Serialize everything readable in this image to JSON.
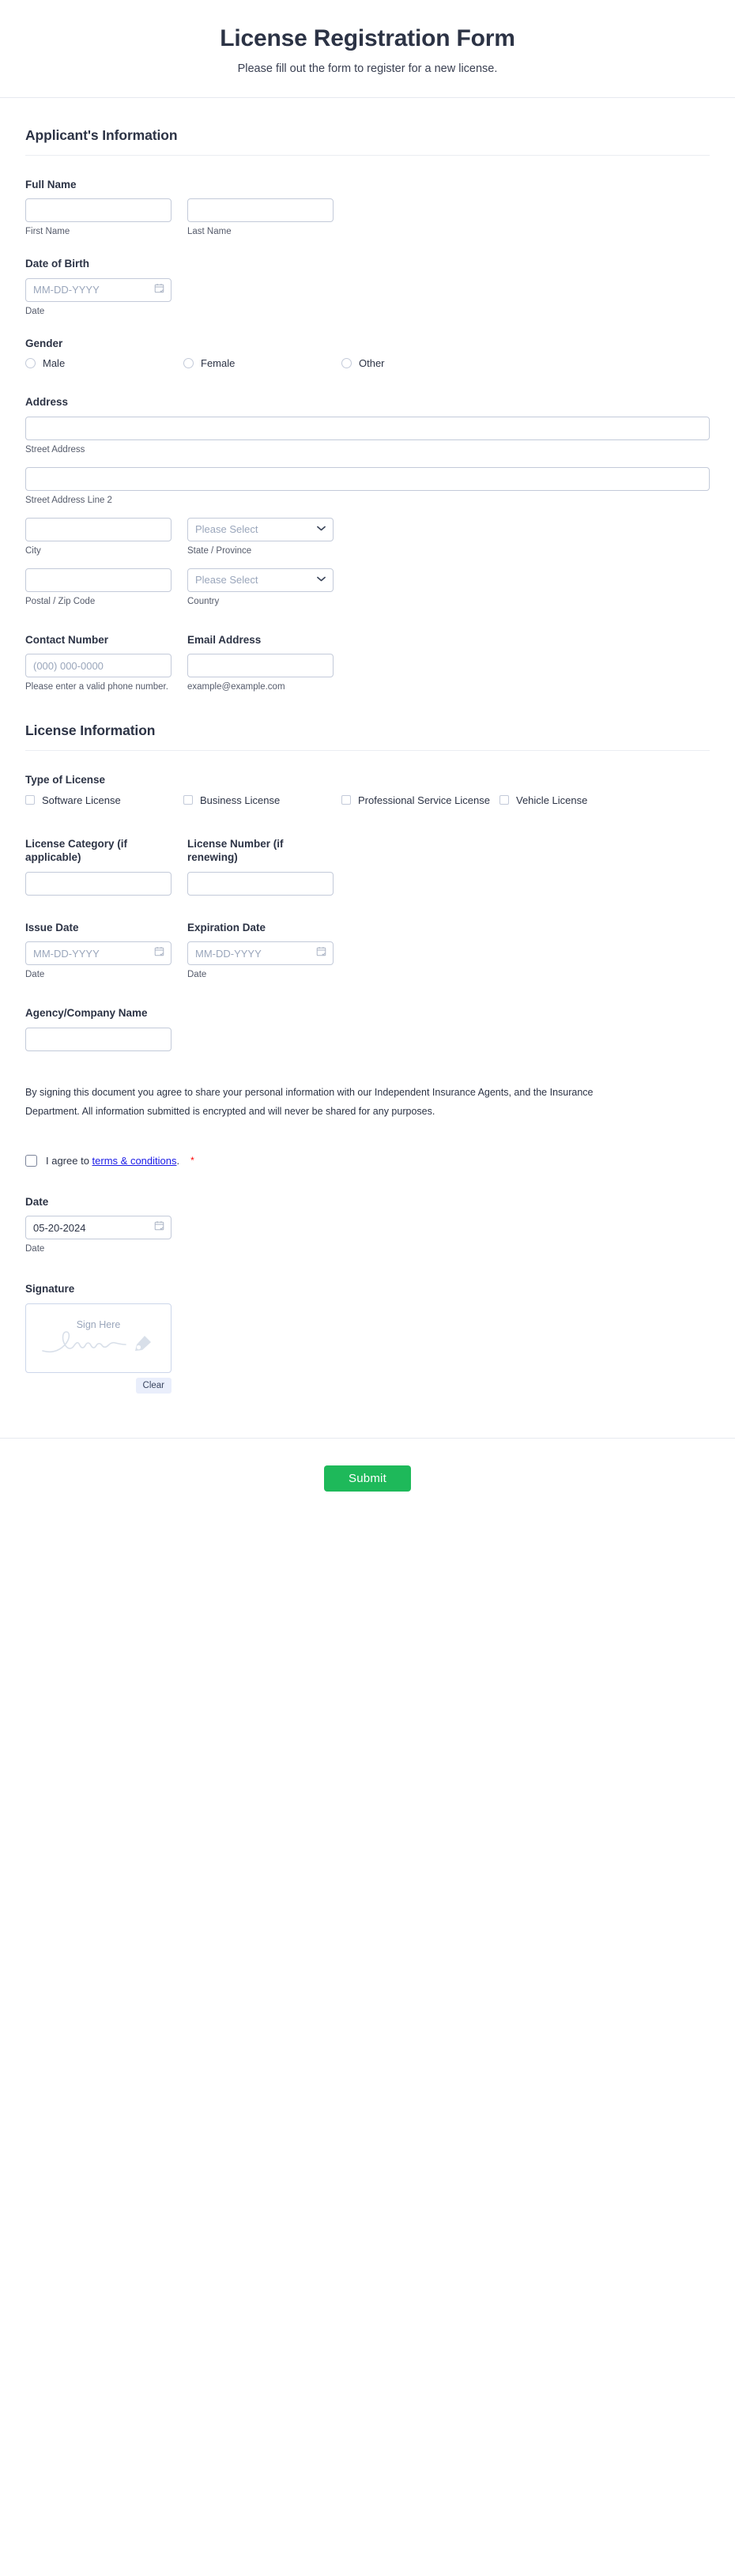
{
  "header": {
    "title": "License Registration Form",
    "subtitle": "Please fill out the form to register for a new license."
  },
  "sections": {
    "applicant": {
      "title": "Applicant's Information"
    },
    "license": {
      "title": "License Information"
    }
  },
  "fields": {
    "full_name": {
      "label": "Full Name",
      "first": {
        "value": "",
        "sub": "First Name"
      },
      "last": {
        "value": "",
        "sub": "Last Name"
      }
    },
    "date_of_birth": {
      "label": "Date of Birth",
      "placeholder": "MM-DD-YYYY",
      "value": "",
      "sub": "Date"
    },
    "gender": {
      "label": "Gender",
      "options": [
        "Male",
        "Female",
        "Other"
      ]
    },
    "address": {
      "label": "Address",
      "street": {
        "value": "",
        "sub": "Street Address"
      },
      "street2": {
        "value": "",
        "sub": "Street Address Line 2"
      },
      "city": {
        "value": "",
        "sub": "City"
      },
      "state": {
        "selected": "Please Select",
        "sub": "State / Province"
      },
      "postal": {
        "value": "",
        "sub": "Postal / Zip Code"
      },
      "country": {
        "selected": "Please Select",
        "sub": "Country"
      }
    },
    "contact_number": {
      "label": "Contact Number",
      "placeholder": "(000) 000-0000",
      "value": "",
      "sub": "Please enter a valid phone number."
    },
    "email_address": {
      "label": "Email Address",
      "value": "",
      "sub": "example@example.com"
    },
    "type_of_license": {
      "label": "Type of License",
      "options": [
        "Software License",
        "Business License",
        "Professional Service License",
        "Vehicle License"
      ]
    },
    "license_category": {
      "label": "License Category (if applicable)",
      "value": ""
    },
    "license_number": {
      "label": "License Number (if renewing)",
      "value": ""
    },
    "issue_date": {
      "label": "Issue Date",
      "placeholder": "MM-DD-YYYY",
      "value": "",
      "sub": "Date"
    },
    "expiration_date": {
      "label": "Expiration Date",
      "placeholder": "MM-DD-YYYY",
      "value": "",
      "sub": "Date"
    },
    "agency_name": {
      "label": "Agency/Company Name",
      "value": ""
    },
    "signing_date": {
      "label": "Date",
      "value": "05-20-2024",
      "sub": "Date"
    },
    "signature": {
      "label": "Signature",
      "placeholder": "Sign Here",
      "clear_label": "Clear"
    }
  },
  "consent": {
    "paragraph": "By signing this document you agree to share your personal information with our Independent Insurance Agents, and the Insurance Department. All information submitted is encrypted and will never be shared for any purposes.",
    "agree_prefix": "I agree to ",
    "agree_link": "terms & conditions",
    "agree_suffix": ".",
    "required_marker": "*"
  },
  "footer": {
    "submit_label": "Submit"
  },
  "colors": {
    "submit_green": "#1eb95a",
    "link_blue": "#1a1ae6",
    "required_red": "#ff0000",
    "heading": "#2c3345",
    "border": "#c3cad9",
    "placeholder": "#9aa6bb",
    "clear_bg": "#e9eefb"
  }
}
